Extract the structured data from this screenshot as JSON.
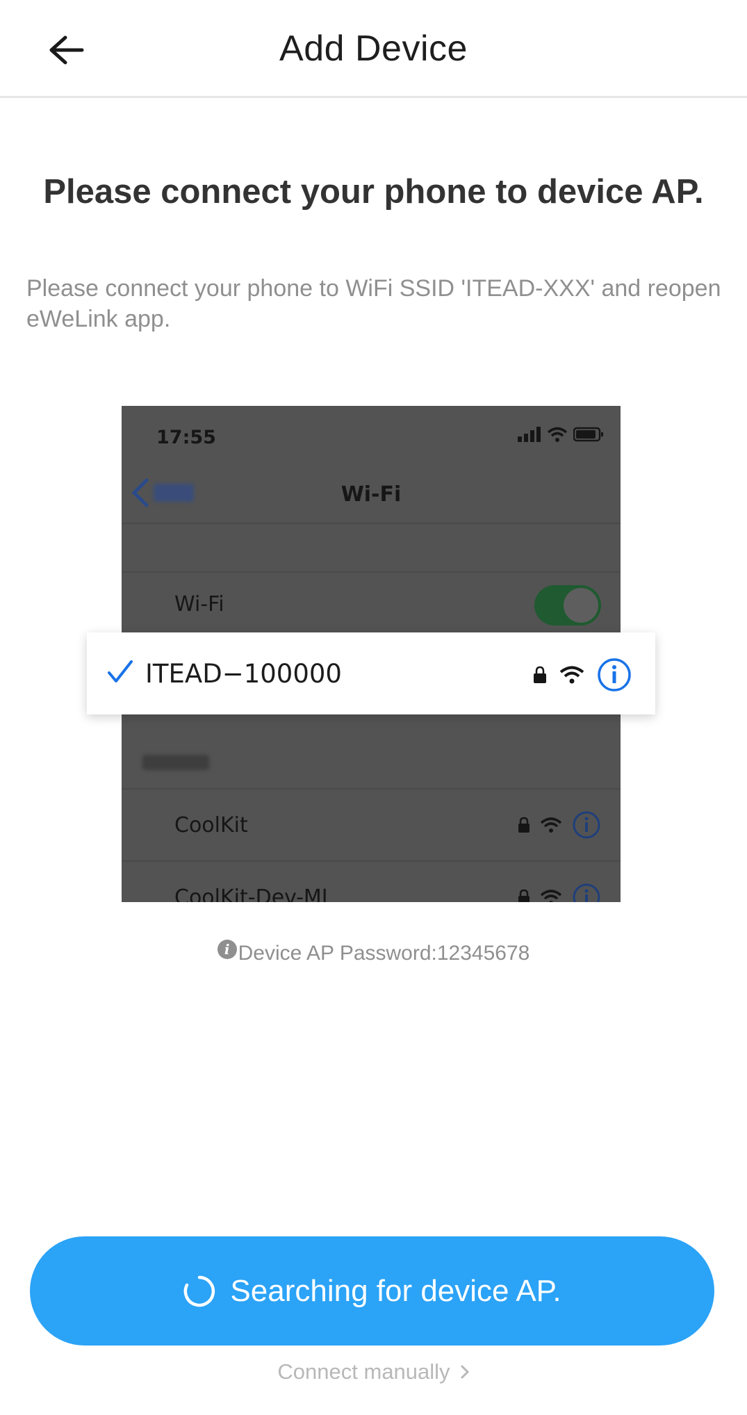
{
  "header": {
    "title": "Add Device",
    "back_icon": "arrow-left-icon"
  },
  "main": {
    "title": "Please connect your phone to device AP.",
    "description": "Please connect your phone to WiFi SSID 'ITEAD-XXX' and reopen eWeLink app."
  },
  "illustration": {
    "time": "17:55",
    "nav_title": "Wi-Fi",
    "wifi_label": "Wi-Fi",
    "selected_ssid": "ITEAD−100000",
    "networks": [
      "CoolKit",
      "CoolKit-Dev-ML"
    ],
    "colors": {
      "link_blue": "#1a73e8",
      "toggle_green": "#1f5a30"
    }
  },
  "ap_password": {
    "text": "Device AP Password:12345678",
    "icon": "info-icon"
  },
  "actions": {
    "search_label": "Searching for device AP.",
    "search_icon": "spinner-icon",
    "connect_manually": "Connect manually",
    "chevron_icon": "chevron-right-icon",
    "button_color": "#2ba3f7"
  }
}
